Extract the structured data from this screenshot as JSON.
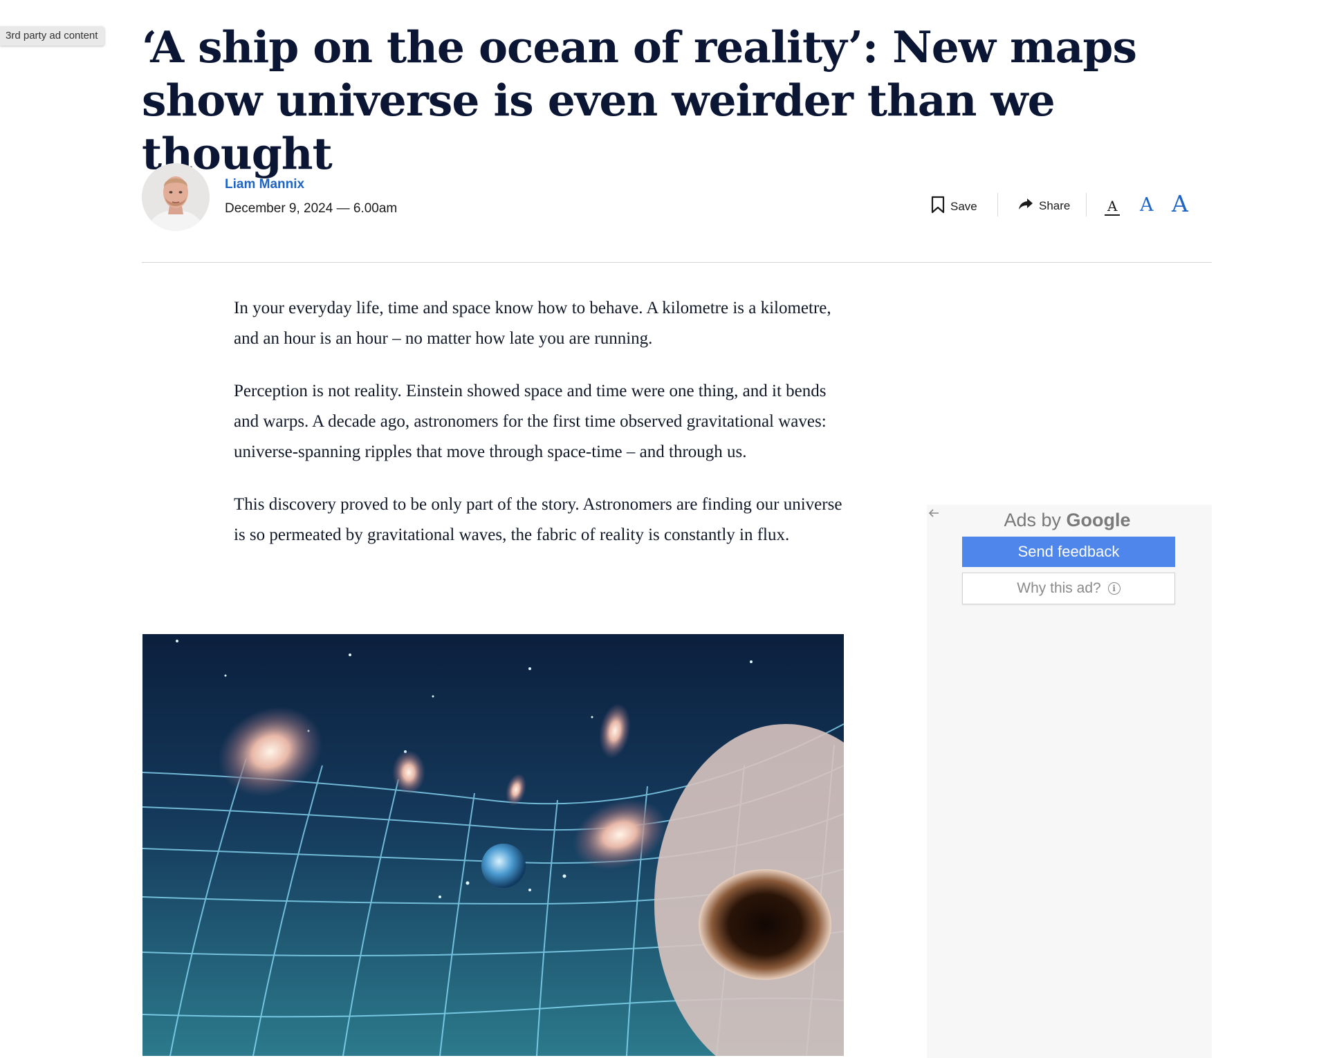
{
  "ad_tag": "3rd party ad content",
  "article": {
    "headline": "‘A ship on the ocean of reality’: New maps show universe is even weirder than we thought",
    "author": "Liam Mannix",
    "date": "December 9, 2024 — 6.00am",
    "paragraphs": [
      "In your everyday life, time and space know how to behave. A kilometre is a kilometre, and an hour is an hour – no matter how late you are running.",
      "Perception is not reality. Einstein showed space and time were one thing, and it bends and warps. A decade ago, astronomers for the first time observed gravitational waves: universe-spanning ripples that move through space-time – and through us.",
      "This discovery proved to be only part of the story. Astronomers are finding our universe is so permeated by gravitational waves, the fabric of reality is constantly in flux."
    ]
  },
  "toolbar": {
    "save_label": "Save",
    "share_label": "Share",
    "font_small": "A",
    "font_medium": "A",
    "font_large": "A"
  },
  "ad_panel": {
    "ads_by_prefix": "Ads by",
    "ads_by_brand": "Google",
    "send_feedback": "Send feedback",
    "why_this_ad": "Why this ad?",
    "info_glyph": "i"
  },
  "icons": {
    "bookmark": "bookmark-icon",
    "share": "share-arrow-icon",
    "back": "back-arrow-icon",
    "info": "info-icon"
  },
  "colors": {
    "accent": "#1e63c6",
    "headline": "#0a1633",
    "feedback_button": "#4f86ec"
  }
}
